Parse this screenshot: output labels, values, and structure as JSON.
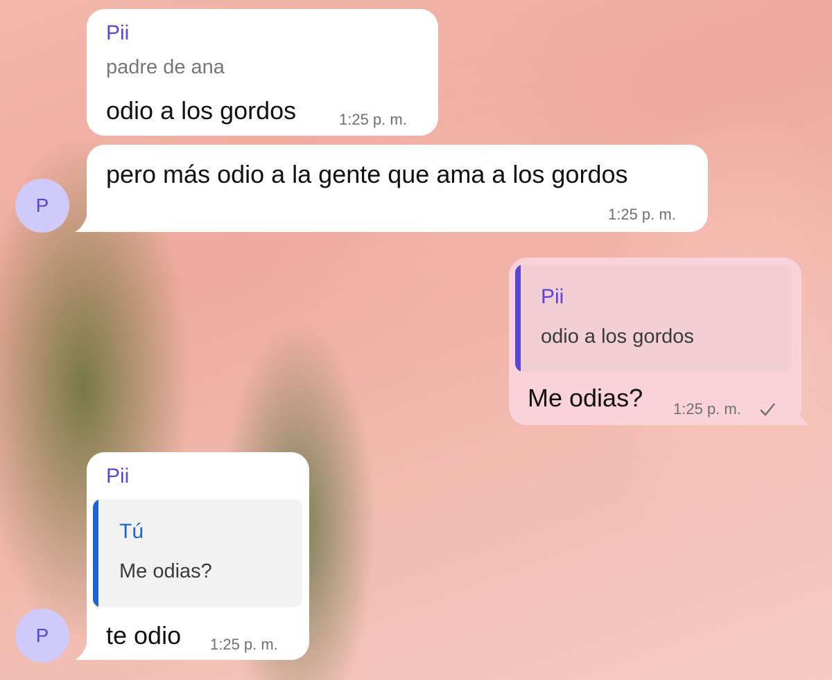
{
  "messages": [
    {
      "sender": "Pii",
      "forwarded_from": "padre de ana",
      "text": "odio a los gordos",
      "time": "1:25 p. m."
    },
    {
      "text": "pero más odio a la gente que ama a los gordos",
      "time": "1:25 p. m.",
      "avatar": "P"
    },
    {
      "quote": {
        "name": "Pii",
        "text": "odio a los gordos",
        "bar_color": "#5b44d6"
      },
      "text": "Me odias?",
      "time": "1:25 p. m.",
      "status": "sent-check-icon"
    },
    {
      "sender": "Pii",
      "quote": {
        "name": "Tú",
        "text": "Me odias?",
        "bar_color": "#1e63d6"
      },
      "text": "te odio",
      "time": "1:25 p. m.",
      "avatar": "P"
    }
  ],
  "colors": {
    "incoming_bubble": "#ffffff",
    "outgoing_bubble": "#f9d2da",
    "sender_name": "#5b44d6",
    "avatar_bg": "#cfcaf9"
  }
}
